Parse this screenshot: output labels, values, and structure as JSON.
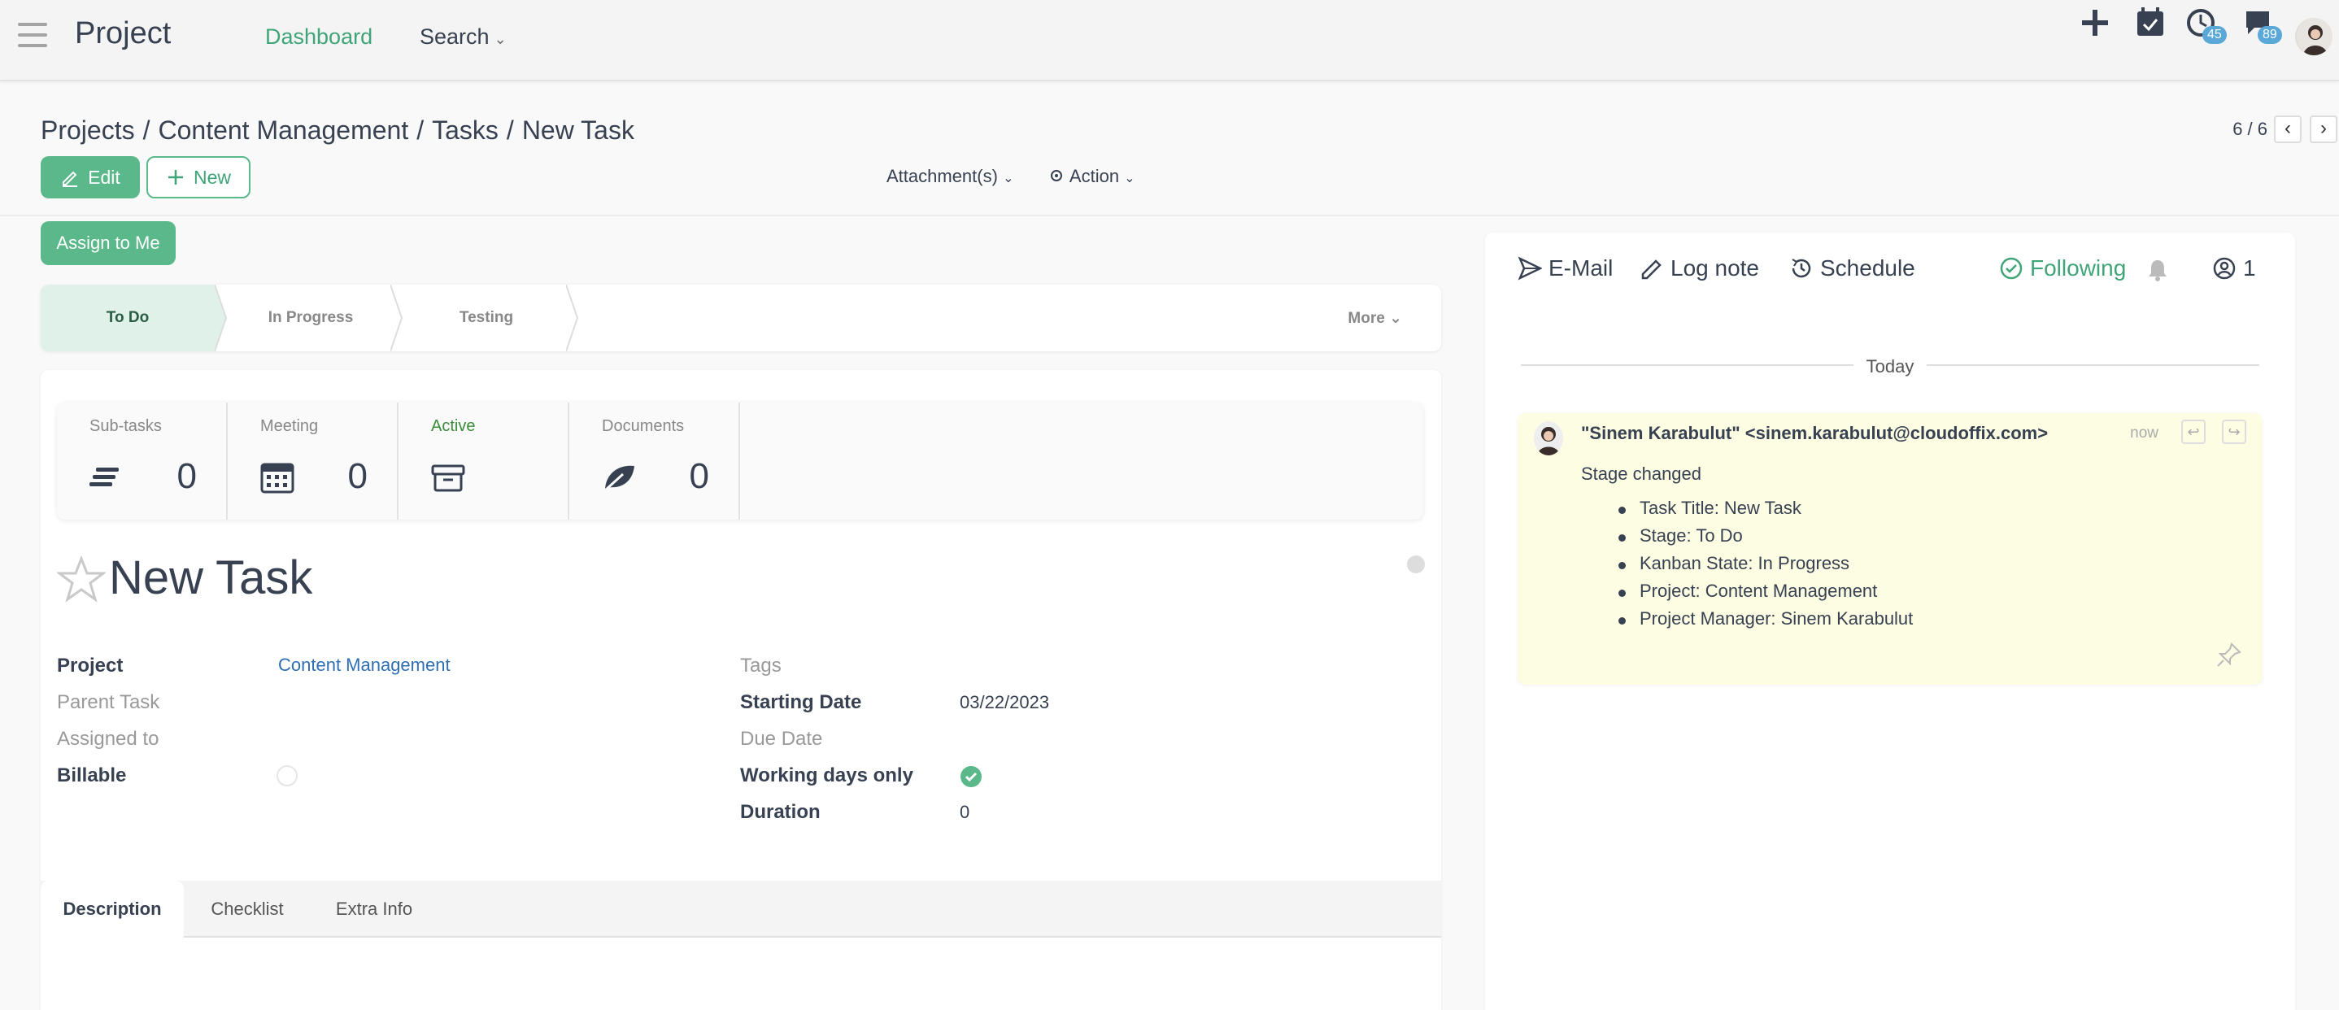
{
  "nav": {
    "app_title": "Project",
    "dashboard": "Dashboard",
    "search": "Search",
    "activity_count": "45",
    "message_count": "89"
  },
  "control": {
    "breadcrumb": [
      "Projects",
      "Content Management",
      "Tasks",
      "New Task"
    ],
    "pager": "6 / 6",
    "edit_label": "Edit",
    "new_label": "New",
    "attachments_label": "Attachment(s)",
    "action_label": "Action"
  },
  "form": {
    "assign_label": "Assign to Me",
    "stages": [
      "To Do",
      "In Progress",
      "Testing"
    ],
    "active_stage": "To Do",
    "more_label": "More",
    "smart_buttons": [
      {
        "label": "Sub-tasks",
        "value": "0",
        "icon": "list-icon"
      },
      {
        "label": "Meeting",
        "value": "0",
        "icon": "calendar-icon"
      },
      {
        "label": "Active",
        "value": "",
        "icon": "archive-icon"
      },
      {
        "label": "Documents",
        "value": "0",
        "icon": "leaf-icon"
      }
    ],
    "title": "New Task",
    "left_fields": [
      {
        "label": "Project",
        "value": "Content Management"
      },
      {
        "label": "Parent Task",
        "value": ""
      },
      {
        "label": "Assigned to",
        "value": ""
      },
      {
        "label": "Billable",
        "value": ""
      }
    ],
    "right_fields": [
      {
        "label": "Tags",
        "value": ""
      },
      {
        "label": "Starting Date",
        "value": "03/22/2023"
      },
      {
        "label": "Due Date",
        "value": ""
      },
      {
        "label": "Working days only",
        "value": ""
      },
      {
        "label": "Duration",
        "value": "0"
      }
    ],
    "tabs": [
      "Description",
      "Checklist",
      "Extra Info"
    ]
  },
  "chatter": {
    "email_label": "E-Mail",
    "log_note_label": "Log note",
    "schedule_label": "Schedule",
    "following_label": "Following",
    "follower_count": "1",
    "today_label": "Today",
    "message": {
      "author": "\"Sinem Karabulut\" <sinem.karabulut@cloudoffix.com>",
      "time": "now",
      "body": "Stage changed",
      "items": [
        "Task Title: New Task",
        "Stage: To Do",
        "Kanban State: In Progress",
        "Project: Content Management",
        "Project Manager: Sinem Karabulut"
      ]
    }
  },
  "colors": {
    "accent": "#5ab88a",
    "accent_text": "#3fa579",
    "link": "#2f6fb5",
    "message_bg": "#fdfde4"
  }
}
